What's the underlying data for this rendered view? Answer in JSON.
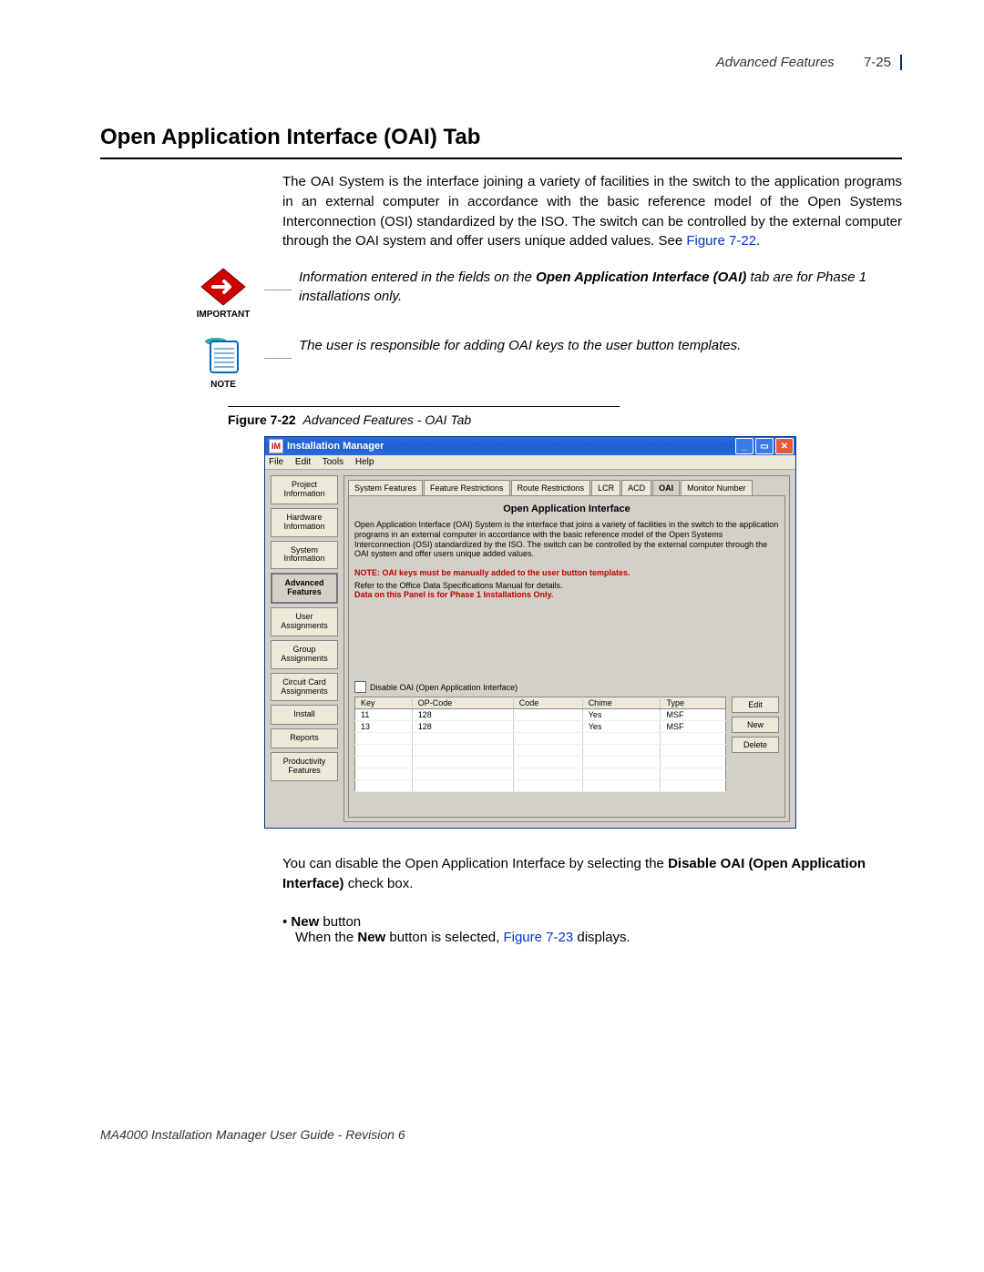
{
  "header": {
    "section": "Advanced Features",
    "page": "7-25"
  },
  "section_title": "Open Application Interface (OAI) Tab",
  "intro": "The OAI System is the interface joining a variety of facilities in the switch to the application programs in an external computer in accordance with the basic reference model of the Open Systems Interconnection (OSI) standardized by the ISO. The switch can be controlled by the external computer through the OAI system and offer users unique added values. See ",
  "intro_link": "Figure 7-22",
  "intro_tail": ".",
  "callouts": {
    "important_label": "IMPORTANT",
    "important_text_pre": "Information entered in the fields on the ",
    "important_text_bold": "Open Application Interface (OAI)",
    "important_text_post": " tab are for Phase 1 installations only.",
    "note_label": "NOTE",
    "note_text": "The user is responsible for adding OAI keys to the user button templates."
  },
  "figure": {
    "label": "Figure 7-22",
    "caption": "Advanced Features - OAI Tab"
  },
  "window": {
    "title": "Installation Manager",
    "app_icon": "IM",
    "menus": [
      "File",
      "Edit",
      "Tools",
      "Help"
    ],
    "sidebar": [
      "Project Information",
      "Hardware Information",
      "System Information",
      "Advanced Features",
      "User Assignments",
      "Group Assignments",
      "Circuit Card Assignments",
      "Install",
      "Reports",
      "Productivity Features"
    ],
    "sidebar_active": 3,
    "tabs": [
      "System Features",
      "Feature Restrictions",
      "Route Restrictions",
      "LCR",
      "ACD",
      "OAI",
      "Monitor Number"
    ],
    "tabs_active": 5,
    "panel_title": "Open Application Interface",
    "panel_desc": "Open Application Interface (OAI) System is the interface that joins a variety of facilities in the switch to the application programs in an external computer in accordance with the basic reference model of the Open Systems Interconnection (OSI) standardized by the ISO. The switch can be controlled by the external computer through the OAI system and offer users unique added values.",
    "panel_note": "NOTE: OAI keys must be manually added to the user button templates.",
    "panel_refer": "Refer to the Office Data Specifications Manual for details.",
    "panel_phase": "Data on this Panel is for Phase 1 Installations Only.",
    "checkbox_label": "Disable OAI (Open Application Interface)",
    "columns": [
      "Key",
      "OP-Code",
      "Code",
      "Chime",
      "Type"
    ],
    "rows": [
      {
        "key": "11",
        "op": "128",
        "code": "",
        "chime": "Yes",
        "type": "MSF"
      },
      {
        "key": "13",
        "op": "128",
        "code": "",
        "chime": "Yes",
        "type": "MSF"
      }
    ],
    "actions": {
      "edit": "Edit",
      "new": "New",
      "delete": "Delete"
    }
  },
  "post_text": {
    "p1_a": "You can disable the Open Application Interface by selecting the ",
    "p1_b": "Disable OAI (Open Application Interface)",
    "p1_c": " check box.",
    "bullet_bold": "New",
    "bullet_rest": " button",
    "sub_a": "When the ",
    "sub_b": "New",
    "sub_c": " button is selected, ",
    "sub_link": "Figure 7-23",
    "sub_d": " displays."
  },
  "footer": "MA4000 Installation Manager User Guide - Revision 6"
}
